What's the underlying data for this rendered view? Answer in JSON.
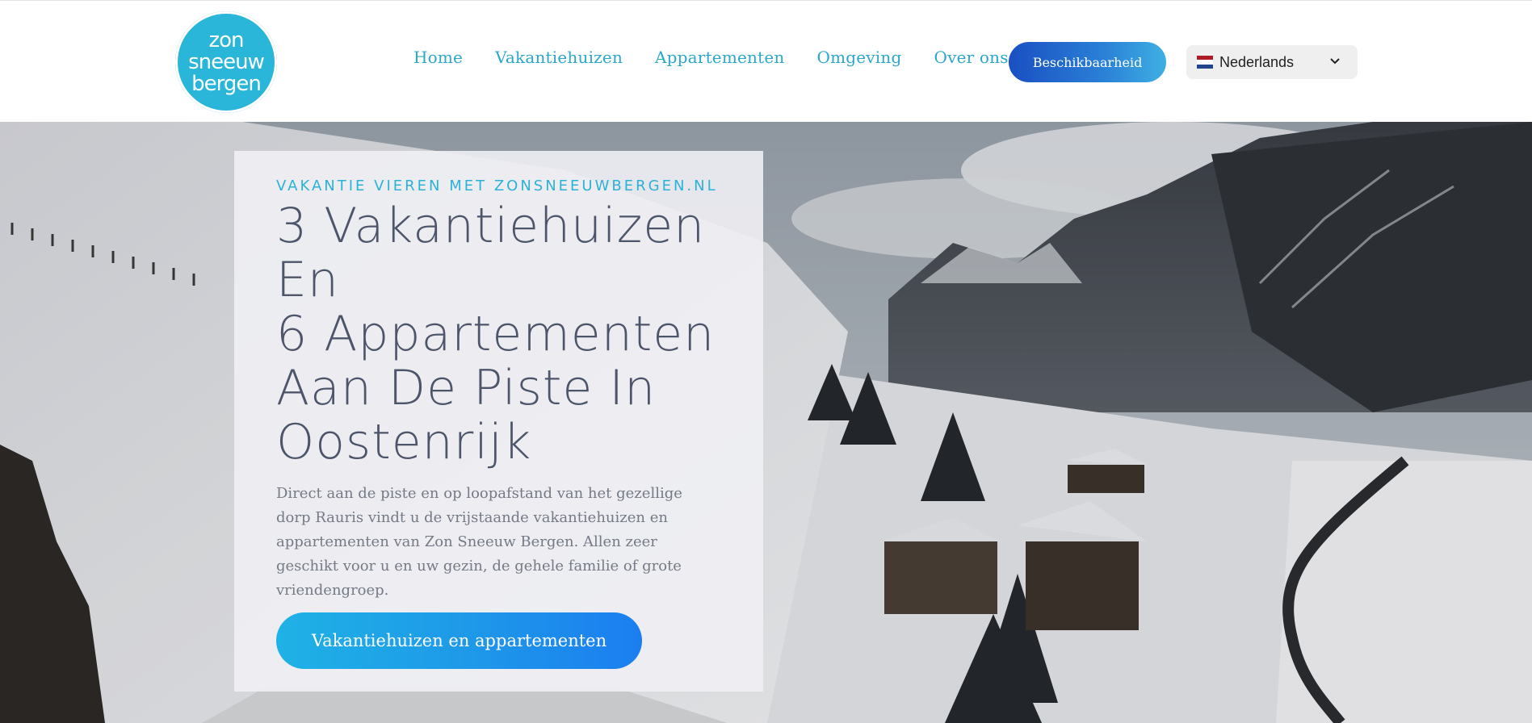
{
  "logo": {
    "line1": "zon",
    "line2": "sneeuw",
    "line3": "bergen"
  },
  "nav": {
    "items": [
      {
        "label": "Home"
      },
      {
        "label": "Vakantiehuizen"
      },
      {
        "label": "Appartementen"
      },
      {
        "label": "Omgeving"
      },
      {
        "label": "Over ons"
      }
    ]
  },
  "header": {
    "cta_label": "Beschikbaarheid",
    "language": "Nederlands"
  },
  "hero": {
    "eyebrow": "VAKANTIE VIEREN MET ZONSNEEUWBERGEN.NL",
    "headline_lines": [
      "3 Vakantiehuizen",
      "En",
      "6 Appartementen",
      "Aan De Piste In",
      "Oostenrijk"
    ],
    "body": "Direct aan de piste en op loopafstand van het gezellige dorp Rauris vindt u de vrijstaande vakantiehuizen en appartementen van Zon Sneeuw Bergen. Allen zeer geschikt voor u en uw gezin, de gehele familie of grote vriendengroep.",
    "cta_label": "Vakantiehuizen en appartementen"
  },
  "colors": {
    "accent": "#2aa8cb",
    "button_dark": "#1a4fc2",
    "headline": "#4d556b",
    "body": "#747a86"
  },
  "icons": {
    "flag": "netherlands-flag-icon",
    "dropdown": "chevron-down-icon"
  }
}
